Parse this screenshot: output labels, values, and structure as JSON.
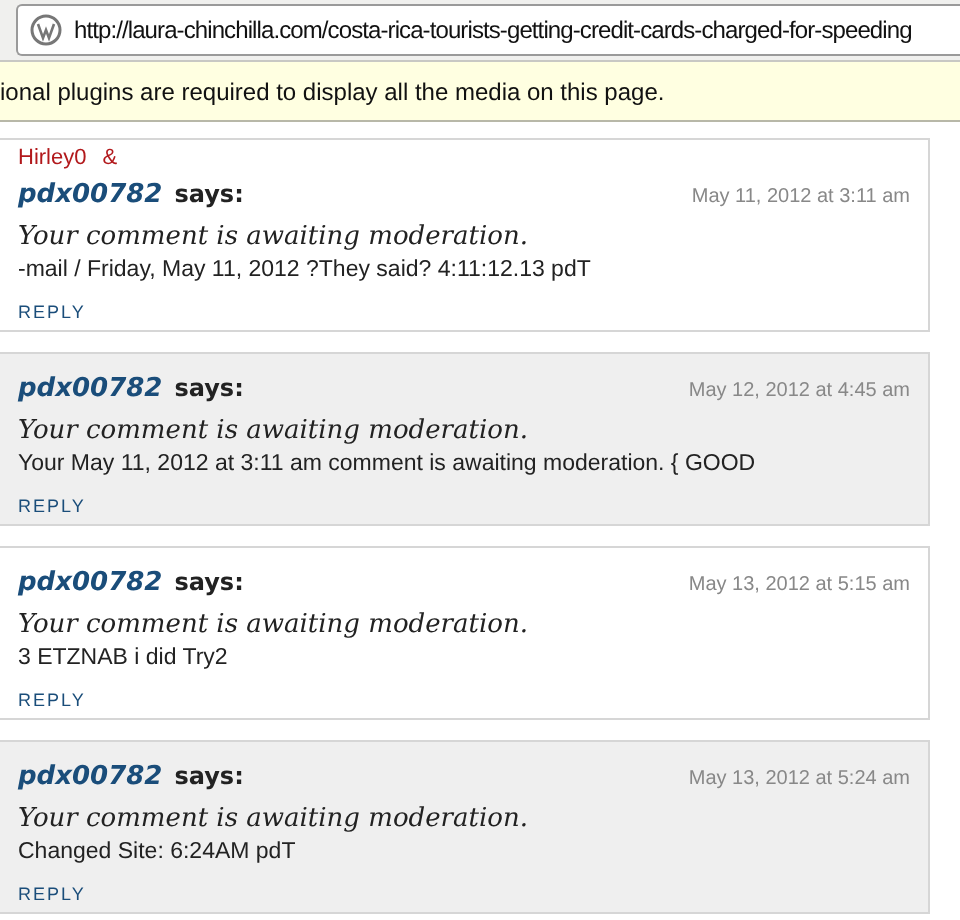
{
  "address_bar": {
    "url": "http://laura-chinchilla.com/costa-rica-tourists-getting-credit-cards-charged-for-speeding"
  },
  "info_bar": {
    "message": "ional plugins are required to display all the media on this page."
  },
  "comments": [
    {
      "annotation": [
        "Hirley0",
        "&"
      ],
      "author": "pdx00782",
      "says": "says:",
      "date": "May 11, 2012 at 3:11 am",
      "moderation": "Your comment is awaiting moderation.",
      "body": "-mail / Friday, May 11, 2012 ?They said? 4:11:12.13 pdT",
      "reply": "REPLY",
      "shaded": false
    },
    {
      "author": "pdx00782",
      "says": "says:",
      "date": "May 12, 2012 at 4:45 am",
      "moderation": "Your comment is awaiting moderation.",
      "body": "Your May 11, 2012 at 3:11 am comment is awaiting moderation. { GOOD",
      "reply": "REPLY",
      "shaded": true
    },
    {
      "author": "pdx00782",
      "says": "says:",
      "date": "May 13, 2012 at 5:15 am",
      "moderation": "Your comment is awaiting moderation.",
      "body": "3 ETZNAB i did Try2",
      "reply": "REPLY",
      "shaded": false
    },
    {
      "author": "pdx00782",
      "says": "says:",
      "date": "May 13, 2012 at 5:24 am",
      "moderation": "Your comment is awaiting moderation.",
      "body": "Changed Site: 6:24AM pdT",
      "reply": "REPLY",
      "shaded": true
    }
  ]
}
